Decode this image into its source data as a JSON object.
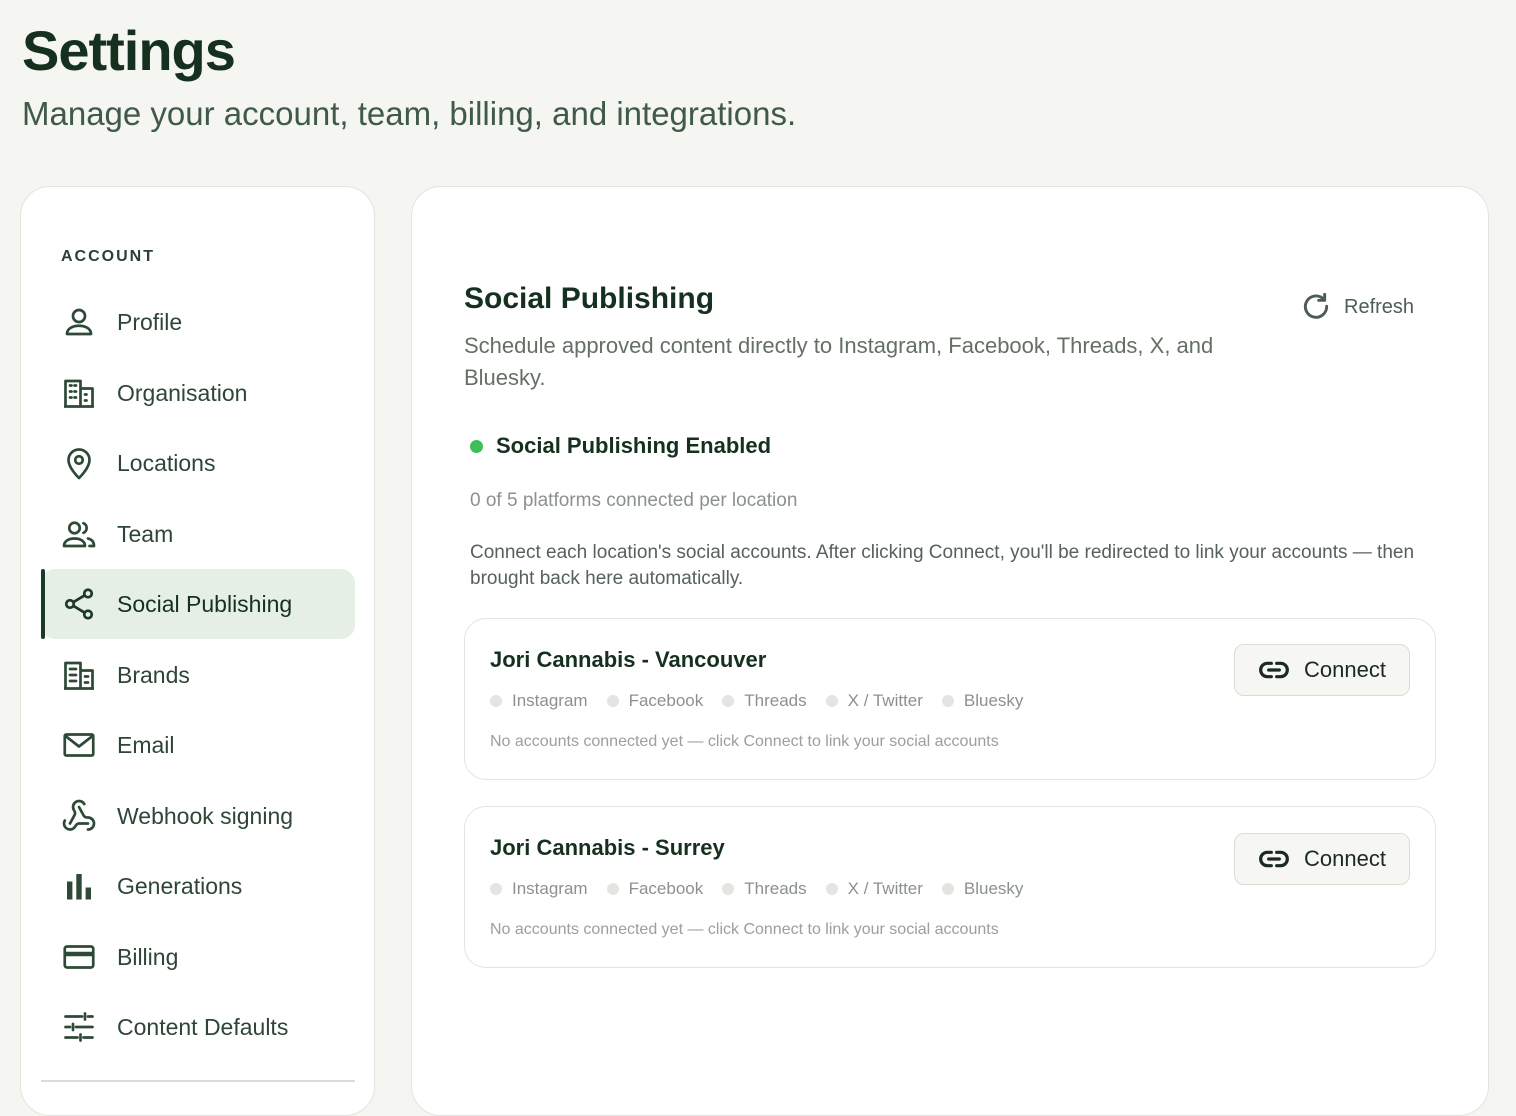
{
  "header": {
    "title": "Settings",
    "subtitle": "Manage your account, team, billing, and integrations."
  },
  "sidebar": {
    "section_label": "ACCOUNT",
    "items": [
      {
        "label": "Profile",
        "icon": "user-icon"
      },
      {
        "label": "Organisation",
        "icon": "building-icon"
      },
      {
        "label": "Locations",
        "icon": "map-pin-icon"
      },
      {
        "label": "Team",
        "icon": "users-icon"
      },
      {
        "label": "Social Publishing",
        "icon": "share-icon",
        "active": true
      },
      {
        "label": "Brands",
        "icon": "brands-icon"
      },
      {
        "label": "Email",
        "icon": "mail-icon"
      },
      {
        "label": "Webhook signing",
        "icon": "webhook-icon"
      },
      {
        "label": "Generations",
        "icon": "bar-chart-icon"
      },
      {
        "label": "Billing",
        "icon": "credit-card-icon"
      },
      {
        "label": "Content Defaults",
        "icon": "sliders-icon"
      }
    ]
  },
  "main": {
    "title": "Social Publishing",
    "description": "Schedule approved content directly to Instagram, Facebook, Threads, X, and Bluesky.",
    "refresh_label": "Refresh",
    "status_label": "Social Publishing Enabled",
    "status_color": "#3fbf5a",
    "platform_count": "0 of 5 platforms connected per location",
    "instructions": "Connect each location's social accounts. After clicking Connect, you'll be redirected to link your accounts — then brought back here automatically.",
    "locations": [
      {
        "name": "Jori Cannabis - Vancouver",
        "platforms": [
          "Instagram",
          "Facebook",
          "Threads",
          "X / Twitter",
          "Bluesky"
        ],
        "hint": "No accounts connected yet — click Connect to link your social accounts",
        "connect_label": "Connect"
      },
      {
        "name": "Jori Cannabis - Surrey",
        "platforms": [
          "Instagram",
          "Facebook",
          "Threads",
          "X / Twitter",
          "Bluesky"
        ],
        "hint": "No accounts connected yet — click Connect to link your social accounts",
        "connect_label": "Connect"
      }
    ]
  },
  "colors": {
    "accent": "#1d3a27",
    "active_bg": "#e6efe6",
    "page_bg": "#f5f5f1"
  }
}
